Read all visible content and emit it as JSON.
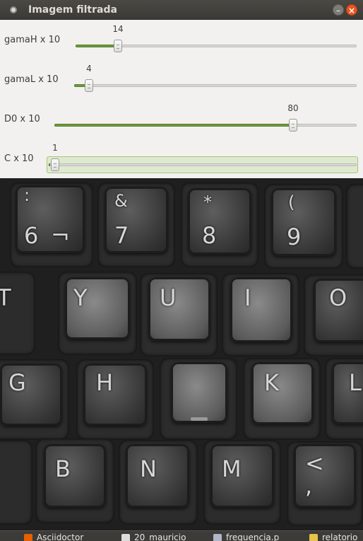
{
  "window": {
    "title": "Imagem filtrada",
    "minimize_symbol": "–",
    "close_symbol": "×"
  },
  "sliders": [
    {
      "label": "gamaH x 10",
      "value": "14",
      "fraction": 0.15
    },
    {
      "label": "gamaL x 10",
      "value": "4",
      "fraction": 0.05
    },
    {
      "label": "D0 x 10",
      "value": "80",
      "fraction": 0.8
    },
    {
      "label": "C x 10",
      "value": "1",
      "fraction": 0.0
    }
  ],
  "image": {
    "description_icon": "filtered-keyboard-image",
    "keys": [
      {
        "top": ":",
        "bottom": "6",
        "extra": "¬"
      },
      {
        "top": "&",
        "bottom": "7"
      },
      {
        "top": "*",
        "bottom": "8"
      },
      {
        "top": "(",
        "bottom": "9"
      },
      {
        "top": "",
        "bottom": "Y"
      },
      {
        "top": "",
        "bottom": "U"
      },
      {
        "top": "",
        "bottom": "I"
      },
      {
        "top": "",
        "bottom": "O"
      },
      {
        "top": "",
        "bottom": "G"
      },
      {
        "top": "",
        "bottom": "H"
      },
      {
        "top": "",
        "bottom": ""
      },
      {
        "top": "",
        "bottom": "K"
      },
      {
        "top": "",
        "bottom": "L"
      },
      {
        "top": "",
        "bottom": "B"
      },
      {
        "top": "",
        "bottom": "N"
      },
      {
        "top": "",
        "bottom": "M"
      },
      {
        "top": "<",
        "bottom": ","
      },
      {
        "top": "",
        "bottom": "T"
      }
    ]
  },
  "taskbar": {
    "items": [
      {
        "label": "Asciidoctor",
        "icon": "firefox-icon",
        "color": "#e66000"
      },
      {
        "label": "20_mauricio",
        "icon": "document-icon",
        "color": "#dcdcdc"
      },
      {
        "label": "frequencia.p",
        "icon": "text-editor-icon",
        "color": "#b0b6c8"
      },
      {
        "label": "relatorio",
        "icon": "writer-icon",
        "color": "#e8c34a"
      }
    ]
  },
  "colors": {
    "accent": "#6f9e3a",
    "close": "#e95420",
    "panel": "#f2f1f0",
    "titlebar": "#3b3a36"
  }
}
